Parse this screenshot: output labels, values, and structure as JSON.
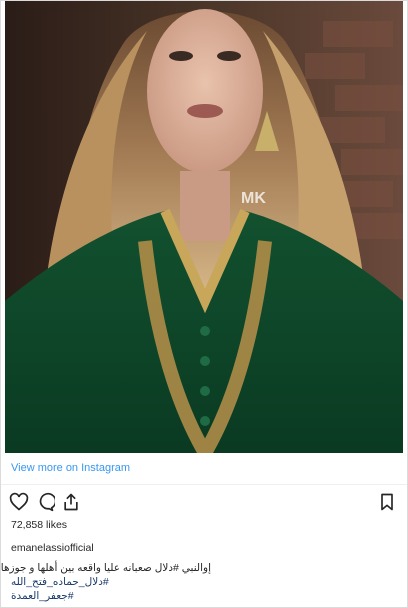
{
  "post": {
    "watermark": "MK",
    "view_more": "View more on Instagram",
    "likes": "72,858 likes",
    "username": "emanelassiofficial",
    "caption_lines": [
      "إوالنبي #دلال صعبانه عليا واقعه بين أهلها و جوزها",
      "#دلال_حماده_فتح_الله",
      "#جعفر_العمدة"
    ]
  },
  "icons": {
    "like": "heart-icon",
    "comment": "comment-icon",
    "share": "share-icon",
    "save": "bookmark-icon"
  },
  "colors": {
    "link": "#3897f0",
    "text": "#262626",
    "hashtag": "#003569",
    "dress": "#0f4a2e"
  }
}
